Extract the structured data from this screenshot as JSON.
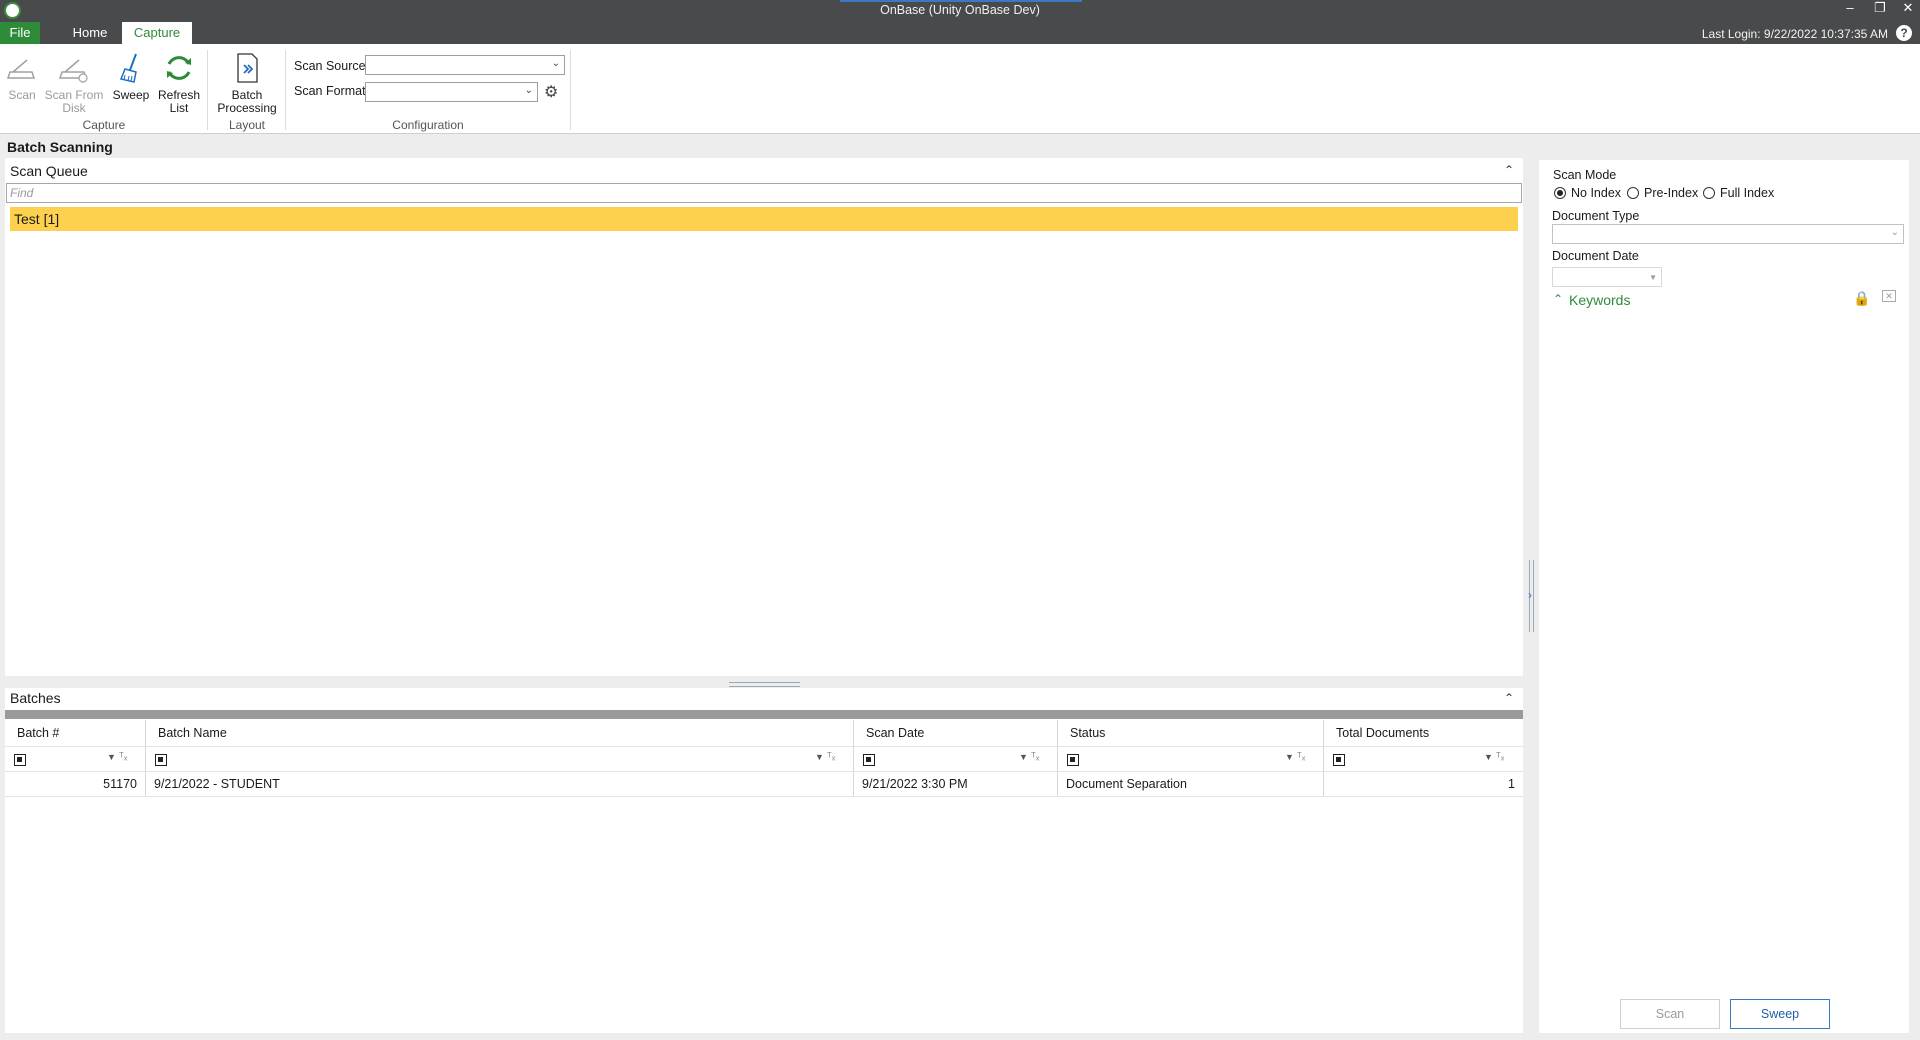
{
  "window": {
    "title": "OnBase (Unity OnBase Dev)",
    "last_login": "Last Login: 9/22/2022 10:37:35 AM",
    "help": "?"
  },
  "ribbon_tabs": {
    "file": "File",
    "home": "Home",
    "capture": "Capture"
  },
  "ribbon": {
    "capture_group": {
      "label": "Capture",
      "scan": "Scan",
      "scan_from_disk_1": "Scan From",
      "scan_from_disk_2": "Disk",
      "sweep": "Sweep",
      "refresh_1": "Refresh",
      "refresh_2": "List"
    },
    "layout_group": {
      "label": "Layout",
      "batch_1": "Batch",
      "batch_2": "Processing"
    },
    "config_group": {
      "label": "Configuration",
      "scan_source_label": "Scan Source",
      "scan_source_value": "",
      "scan_format_label": "Scan Format",
      "scan_format_value": ""
    }
  },
  "main": {
    "section_title": "Batch Scanning",
    "scan_queue": {
      "title": "Scan Queue",
      "find_placeholder": "Find",
      "items": [
        "Test [1]"
      ]
    },
    "batches": {
      "title": "Batches",
      "columns": [
        "Batch #",
        "Batch Name",
        "Scan Date",
        "Status",
        "Total Documents"
      ],
      "rows": [
        {
          "batch_no": "51170",
          "batch_name": "9/21/2022 - STUDENT",
          "scan_date": "9/21/2022 3:30 PM",
          "status": "Document Separation",
          "total_documents": "1"
        }
      ]
    }
  },
  "right_panel": {
    "scan_mode_label": "Scan Mode",
    "modes": [
      "No Index",
      "Pre-Index",
      "Full Index"
    ],
    "selected_mode": "No Index",
    "document_type_label": "Document Type",
    "document_type_value": "",
    "document_date_label": "Document Date",
    "document_date_value": "",
    "keywords_label": "Keywords",
    "scan_button": "Scan",
    "sweep_button": "Sweep"
  },
  "colors": {
    "accent_green": "#2e8b3a",
    "highlight_yellow": "#fdd14e",
    "titlebar": "#494a4c",
    "accent_blue": "#3a78c4"
  }
}
